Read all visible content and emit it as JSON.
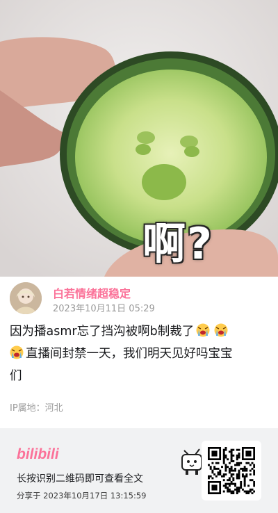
{
  "image": {
    "caption": "啊?"
  },
  "post": {
    "username": "白若情绪超稳定",
    "timestamp": "2023年10月11日 05:29",
    "text_line1": "因为播asmr忘了挡沟被啊b制裁了",
    "text_line2": "直播间封禁一天，我们明天见好吗宝宝",
    "text_line3": "们",
    "emoji_name": "crying-face-emoji",
    "ip_location": "IP属地：河北"
  },
  "footer": {
    "brand": "bilibili",
    "scan_hint": "长按识别二维码即可查看全文",
    "share_time": "分享于 2023年10月17日 13:15:59"
  },
  "colors": {
    "accent_pink": "#fb7299",
    "footer_bg": "#f1f2f3"
  }
}
